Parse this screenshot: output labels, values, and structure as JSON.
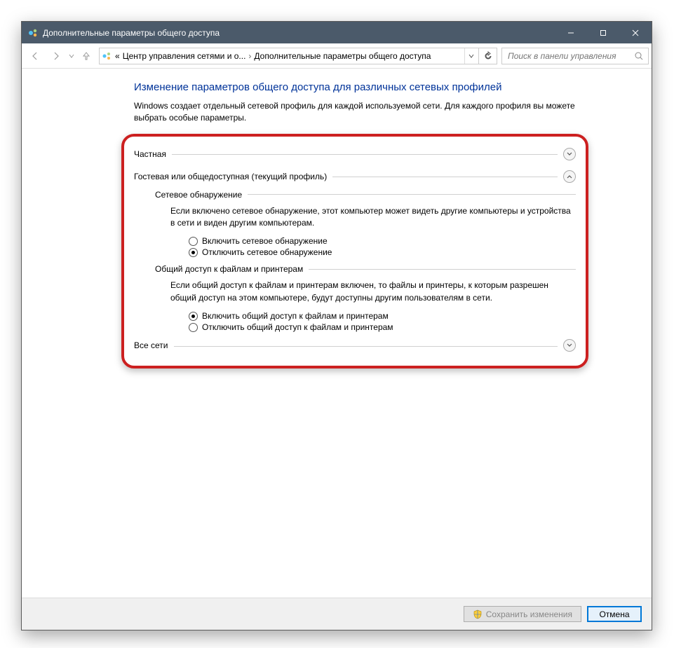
{
  "window": {
    "title": "Дополнительные параметры общего доступа"
  },
  "breadcrumb": {
    "prefix": "«",
    "item1": "Центр управления сетями и о...",
    "item2": "Дополнительные параметры общего доступа"
  },
  "search": {
    "placeholder": "Поиск в панели управления"
  },
  "page": {
    "heading": "Изменение параметров общего доступа для различных сетевых профилей",
    "intro": "Windows создает отдельный сетевой профиль для каждой используемой сети. Для каждого профиля вы можете выбрать особые параметры."
  },
  "sections": {
    "private": {
      "label": "Частная"
    },
    "guest": {
      "label": "Гостевая или общедоступная (текущий профиль)",
      "discovery": {
        "title": "Сетевое обнаружение",
        "desc": "Если включено сетевое обнаружение, этот компьютер может видеть другие компьютеры и устройства в сети и виден другим компьютерам.",
        "opt_on": "Включить сетевое обнаружение",
        "opt_off": "Отключить сетевое обнаружение"
      },
      "fileshare": {
        "title": "Общий доступ к файлам и принтерам",
        "desc": "Если общий доступ к файлам и принтерам включен, то файлы и принтеры, к которым разрешен общий доступ на этом компьютере, будут доступны другим пользователям в сети.",
        "opt_on": "Включить общий доступ к файлам и принтерам",
        "opt_off": "Отключить общий доступ к файлам и принтерам"
      }
    },
    "all": {
      "label": "Все сети"
    }
  },
  "footer": {
    "save": "Сохранить изменения",
    "cancel": "Отмена"
  }
}
